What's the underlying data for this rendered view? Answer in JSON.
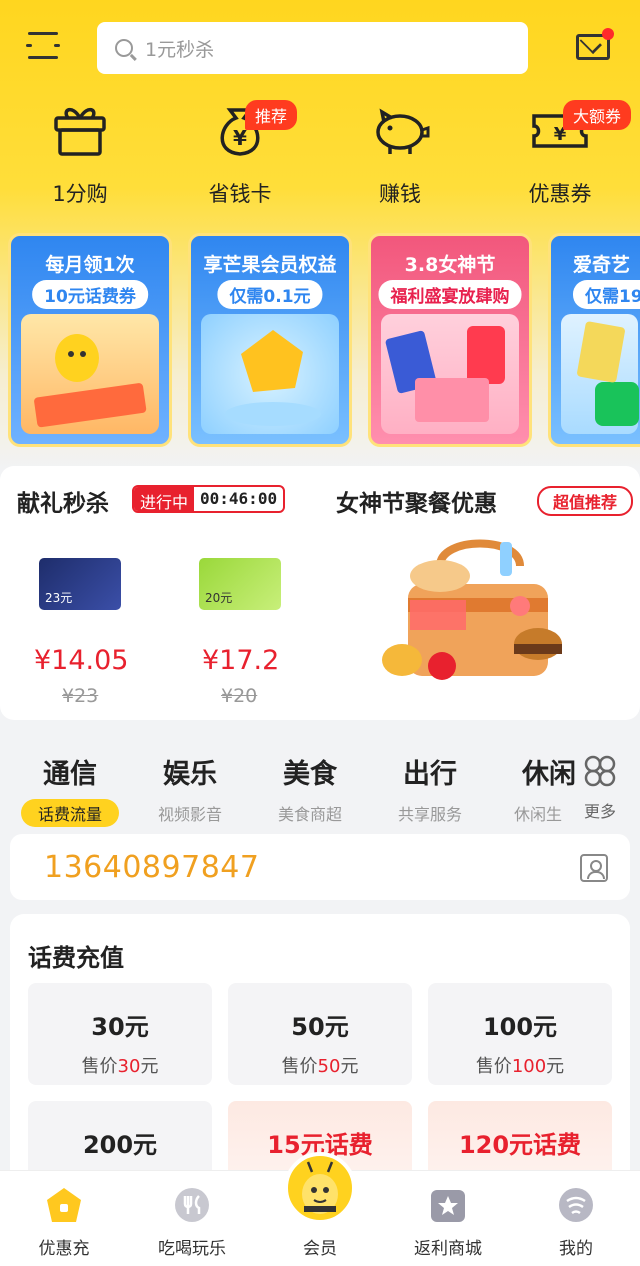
{
  "search": {
    "placeholder": "1元秒杀"
  },
  "quick": [
    {
      "label": "1分购",
      "icon": "gift-box-icon"
    },
    {
      "label": "省钱卡",
      "icon": "money-bag-icon",
      "tag": "推荐"
    },
    {
      "label": "赚钱",
      "icon": "piggy-bank-icon"
    },
    {
      "label": "优惠券",
      "icon": "coupon-icon",
      "tag": "大额券"
    }
  ],
  "promos": [
    {
      "line1": "每月领1次",
      "line2": "10元话费券",
      "color": "#2f86f0"
    },
    {
      "line1": "享芒果会员权益",
      "line2": "仅需0.1元",
      "color": "#2f86f0"
    },
    {
      "line1": "3.8女神节",
      "line2": "福利盛宴放肆购",
      "color": "#f2577c"
    },
    {
      "line1": "爱奇艺",
      "line2": "仅需19",
      "color": "#2f86f0"
    }
  ],
  "flash": {
    "title": "献礼秒杀",
    "status": "进行中",
    "timer": "00:46:00",
    "items": [
      {
        "card_value": "23元",
        "price": "¥14.05",
        "original": "¥23"
      },
      {
        "card_value": "20元",
        "price": "¥17.2",
        "original": "¥20"
      }
    ],
    "party_title": "女神节聚餐优惠",
    "party_tag": "超值推荐"
  },
  "categories": [
    {
      "name": "通信",
      "sub": "话费流量"
    },
    {
      "name": "娱乐",
      "sub": "视频影音"
    },
    {
      "name": "美食",
      "sub": "美食商超"
    },
    {
      "name": "出行",
      "sub": "共享服务"
    },
    {
      "name": "休闲",
      "sub": "休闲生"
    }
  ],
  "more_label": "更多",
  "phone": "13640897847",
  "recharge": {
    "title": "话费充值",
    "price_prefix": "售价",
    "options": [
      {
        "value": "30元",
        "price": "30",
        "unit": "元"
      },
      {
        "value": "50元",
        "price": "50",
        "unit": "元"
      },
      {
        "value": "100元",
        "price": "100",
        "unit": "元"
      },
      {
        "value": "200元"
      },
      {
        "value": "15元话费"
      },
      {
        "value": "120元话费"
      }
    ]
  },
  "nav": [
    {
      "label": "优惠充",
      "icon": "home-icon",
      "active": true
    },
    {
      "label": "吃喝玩乐",
      "icon": "fork-icon"
    },
    {
      "label": "会员",
      "icon": "bee-mascot-icon"
    },
    {
      "label": "返利商城",
      "icon": "star-bag-icon"
    },
    {
      "label": "我的",
      "icon": "profile-icon"
    }
  ],
  "colors": {
    "brand_yellow": "#ffd61f",
    "accent_red": "#e8212e",
    "phone_orange": "#f0a020"
  }
}
